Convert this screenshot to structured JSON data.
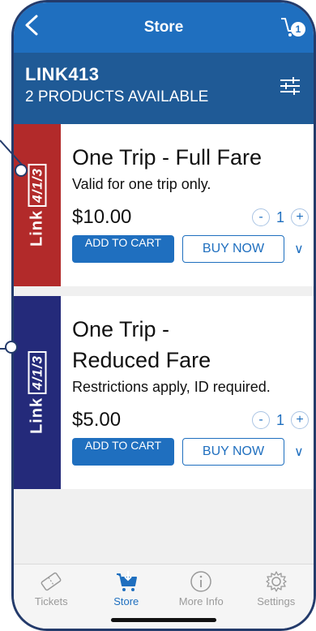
{
  "nav": {
    "title": "Store",
    "cart_count": "1"
  },
  "header": {
    "title": "LINK413",
    "subtitle": "2 PRODUCTS AVAILABLE"
  },
  "products": [
    {
      "brand_text": "Link",
      "brand_num": "4/1/3",
      "stripe_color": "#b22a2a",
      "name": "One Trip - Full Fare",
      "description": "Valid for one trip only.",
      "price": "$10.00",
      "qty": "1",
      "add_to_cart": "ADD TO CART",
      "buy_now": "BUY NOW"
    },
    {
      "brand_text": "Link",
      "brand_num": "4/1/3",
      "stripe_color": "#242a7a",
      "name": "One Trip - Reduced Fare",
      "description": "Restrictions apply, ID required.",
      "price": "$5.00",
      "qty": "1",
      "add_to_cart": "ADD TO CART",
      "buy_now": "BUY NOW"
    }
  ],
  "tabs": [
    {
      "label": "Tickets",
      "icon": "tickets-icon",
      "active": false
    },
    {
      "label": "Store",
      "icon": "store-cart-icon",
      "active": true
    },
    {
      "label": "More Info",
      "icon": "info-icon",
      "active": false
    },
    {
      "label": "Settings",
      "icon": "gear-icon",
      "active": false
    }
  ],
  "colors": {
    "nav_blue": "#1f6fbf",
    "header_blue": "#1f5a96",
    "frame": "#243b6b"
  }
}
